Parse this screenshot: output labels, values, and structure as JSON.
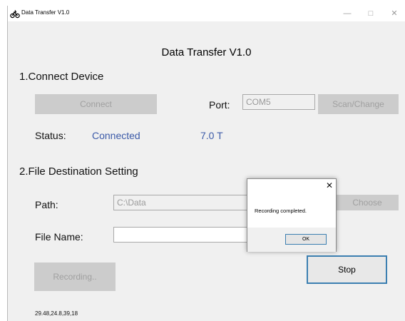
{
  "window": {
    "title": "Data Transfer V1.0",
    "minimize_glyph": "—",
    "maximize_glyph": "□",
    "close_glyph": "✕",
    "app_icon": "bicycle-icon"
  },
  "heading": "Data Transfer V1.0",
  "connect_section": {
    "title": "1.Connect Device",
    "connect_button": "Connect",
    "port_label": "Port:",
    "port_value": "COM5",
    "scan_button": "Scan/Change",
    "status_label": "Status:",
    "status_value": "Connected",
    "field_strength": "7.0 T"
  },
  "file_section": {
    "title": "2.File Destination Setting",
    "path_label": "Path:",
    "path_value": "C:\\Data",
    "choose_button": "Choose",
    "filename_label": "File Name:",
    "filename_value": ""
  },
  "recording_button": "Recording..",
  "stop_button": "Stop",
  "footer_readout": "29.48,24.8,39,18",
  "dialog": {
    "message": "Recording completed.",
    "ok_button": "OK",
    "close_glyph": "✕"
  },
  "colors": {
    "accent_blue": "#3b5aa8",
    "focus_border": "#3c7fb1",
    "disabled_button": "#cccccc"
  }
}
